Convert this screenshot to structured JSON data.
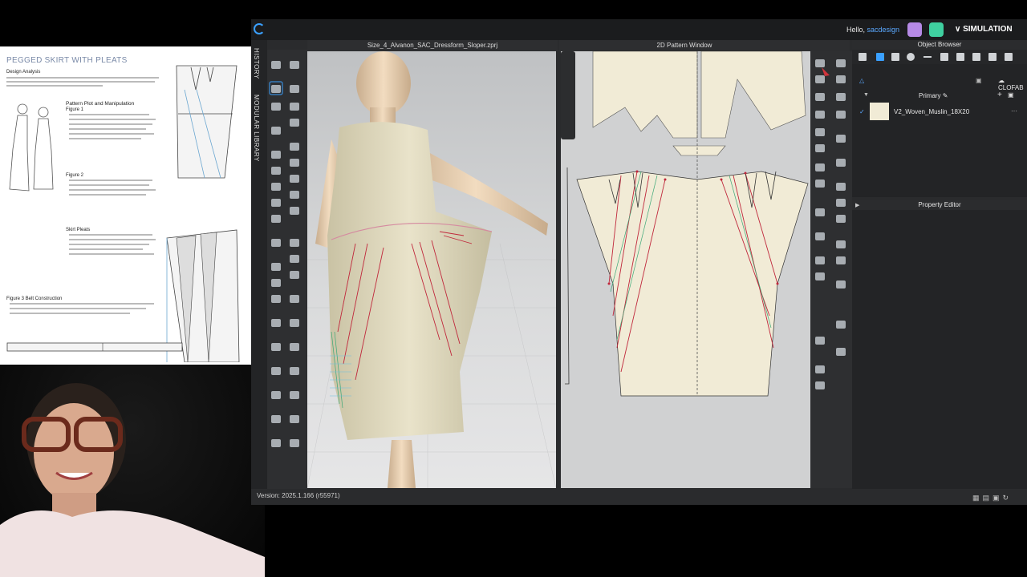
{
  "app": {
    "greeting": "Hello,",
    "username": "sacdesign",
    "mode_label": "SIMULATION",
    "side_tabs": [
      "HISTORY",
      "MODULAR LIBRARY"
    ],
    "version": "Version: 2025.1.166 (r55971)"
  },
  "window_3d": {
    "title": "Size_4_Alvanon_SAC_Dressform_Sloper.zprj"
  },
  "window_2d": {
    "title": "2D Pattern Window"
  },
  "object_browser": {
    "title": "Object Browser",
    "library_label": "CLOFAB",
    "group_label": "Primary",
    "fabric_name": "V2_Woven_Muslin_18X20"
  },
  "property_editor": {
    "title": "Property Editor"
  },
  "document": {
    "title": "PEGGED SKIRT WITH PLEATS",
    "design_analysis": "Design Analysis",
    "pattern_plot": "Pattern Plot and Manipulation",
    "figure_1": "Figure 1",
    "figure_2": "Figure 2",
    "skirt_pleats": "Skirt Pleats",
    "figure_3": "Figure 3 Belt Construction"
  },
  "colors": {
    "accent": "#3aa0ff",
    "fabric": "#f1ebd6",
    "pattern_red": "#c0283c",
    "pattern_green": "#3ca878"
  }
}
